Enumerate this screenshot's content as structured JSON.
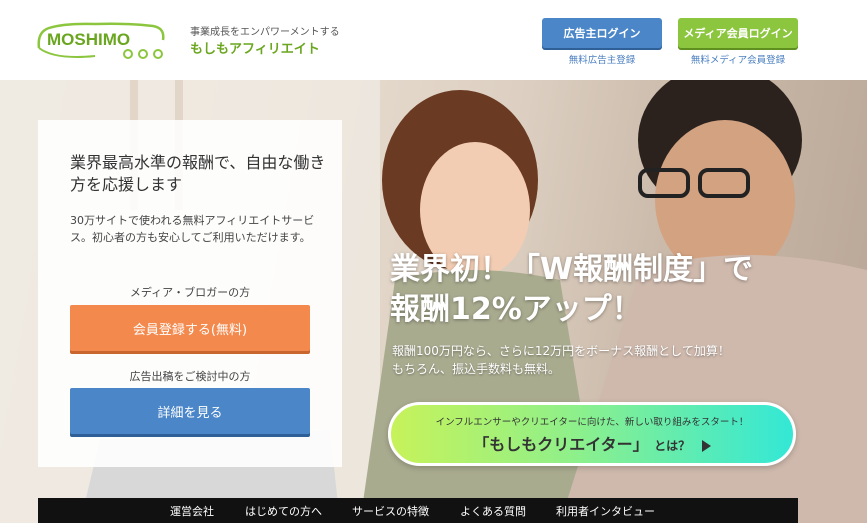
{
  "header": {
    "logo_text": "MOSHIMO",
    "tagline_small": "事業成長をエンパワーメントする",
    "tagline_main": "もしもアフィリエイト",
    "advertiser_login": "広告主ログイン",
    "media_login": "メディア会員ログイン",
    "advertiser_register": "無料広告主登録",
    "media_register": "無料メディア会員登録"
  },
  "panel": {
    "title": "業界最高水準の報酬で、自由な働き方を応援します",
    "description": "30万サイトで使われる無料アフィリエイトサービス。初心者の方も安心してご利用いただけます。",
    "media_label": "メディア・ブロガーの方",
    "register_button": "会員登録する(無料)",
    "advertiser_label": "広告出稿をご検討中の方",
    "detail_button": "詳細を見る"
  },
  "promo": {
    "title_line1": "業界初！「W報酬制度」で",
    "title_line2": "報酬12%アップ！",
    "sub_line1": "報酬100万円なら、さらに12万円をボーナス報酬として加算！",
    "sub_line2": "もちろん、振込手数料も無料。"
  },
  "creator_banner": {
    "small_text": "インフルエンサーやクリエイターに向けた、新しい取り組みをスタート！",
    "main_text": "「もしもクリエイター」",
    "suffix": "とは？"
  },
  "nav": {
    "items": [
      "運営会社",
      "はじめての方へ",
      "サービスの特徴",
      "よくある質問",
      "利用者インタビュー"
    ]
  },
  "colors": {
    "brand_green": "#8cc63f",
    "accent_blue": "#4a86c8",
    "accent_orange": "#f4894d"
  },
  "icons": {
    "creator_arrow": "play-icon"
  }
}
